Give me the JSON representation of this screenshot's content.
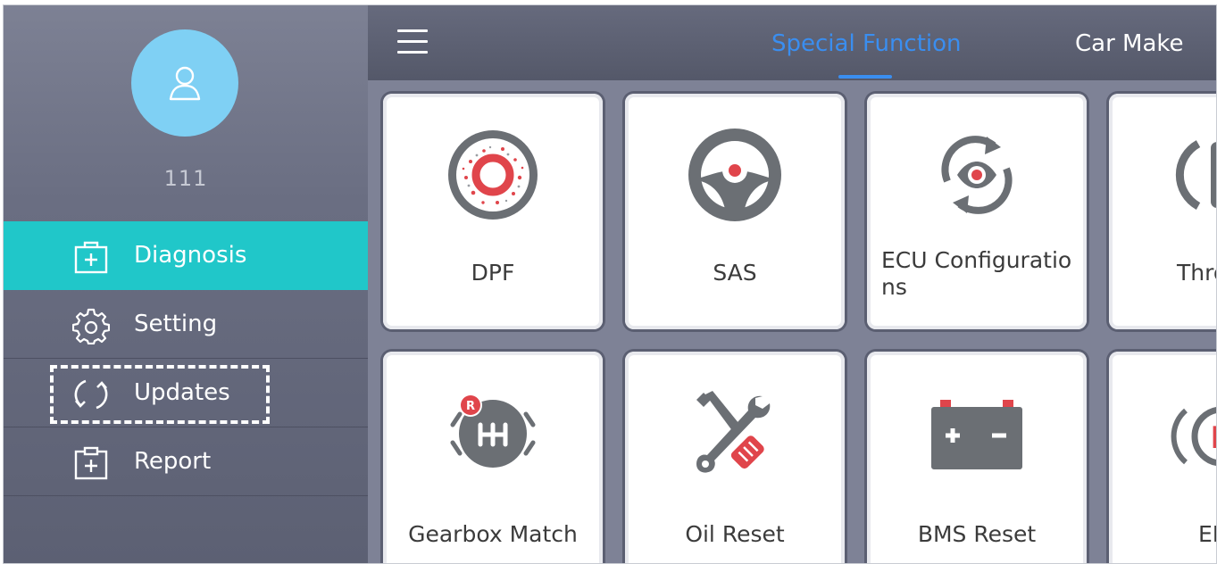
{
  "user": {
    "name": "111",
    "avatar_icon": "user-icon"
  },
  "sidebar": {
    "items": [
      {
        "label": "Diagnosis",
        "icon": "medical-kit-icon",
        "active": true
      },
      {
        "label": "Setting",
        "icon": "gear-icon",
        "active": false
      },
      {
        "label": "Updates",
        "icon": "refresh-icon",
        "active": false
      },
      {
        "label": "Report",
        "icon": "report-icon",
        "active": false
      }
    ]
  },
  "topbar": {
    "menu_icon": "hamburger-icon",
    "tabs": [
      {
        "label": "Special Function",
        "active": true
      },
      {
        "label": "Car Make",
        "active": false
      }
    ]
  },
  "functions": [
    {
      "label": "DPF",
      "icon": "dpf-icon"
    },
    {
      "label": "SAS",
      "icon": "steering-wheel-icon"
    },
    {
      "label": "ECU Configuratio\nns",
      "icon": "ecu-config-icon"
    },
    {
      "label": "Thro",
      "icon": "throttle-icon"
    },
    {
      "label": "Gearbox Match",
      "icon": "gearbox-icon"
    },
    {
      "label": "Oil Reset",
      "icon": "wrench-icon"
    },
    {
      "label": "BMS Reset",
      "icon": "battery-icon"
    },
    {
      "label": "EP",
      "icon": "parking-brake-icon"
    }
  ],
  "colors": {
    "accent": "#20c7c9",
    "tab_active": "#3a8ef0",
    "icon_red": "#e0454b",
    "icon_gray": "#6b6f74"
  }
}
